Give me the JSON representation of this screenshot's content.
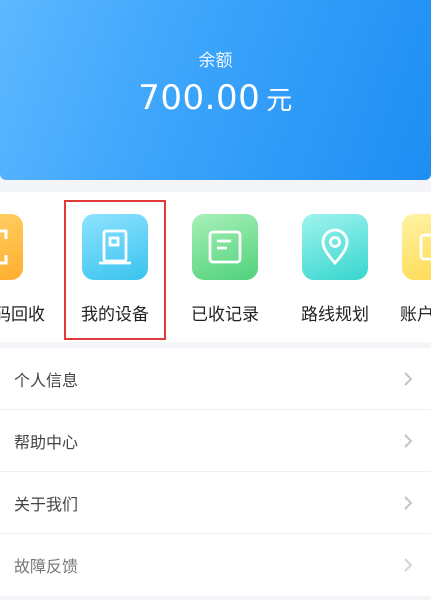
{
  "balance": {
    "label": "余额",
    "amount": "700.00",
    "unit": "元"
  },
  "shortcuts": [
    {
      "label": "码回收",
      "icon": "scan-frame-icon",
      "color": "#ffb733"
    },
    {
      "label": "我的设备",
      "icon": "device-door-icon",
      "color": "#4cc8f0",
      "highlighted": true
    },
    {
      "label": "已收记录",
      "icon": "record-card-icon",
      "color": "#5ad585"
    },
    {
      "label": "路线规划",
      "icon": "location-pin-icon",
      "color": "#3ed8d0"
    },
    {
      "label": "账户",
      "icon": "account-icon",
      "color": "#ffd84a"
    }
  ],
  "menu": [
    {
      "label": "个人信息"
    },
    {
      "label": "帮助中心"
    },
    {
      "label": "关于我们"
    },
    {
      "label": "故障反馈"
    }
  ],
  "colors": {
    "brand_blue": "#3aa3fb",
    "highlight_red": "#e03a3a"
  }
}
